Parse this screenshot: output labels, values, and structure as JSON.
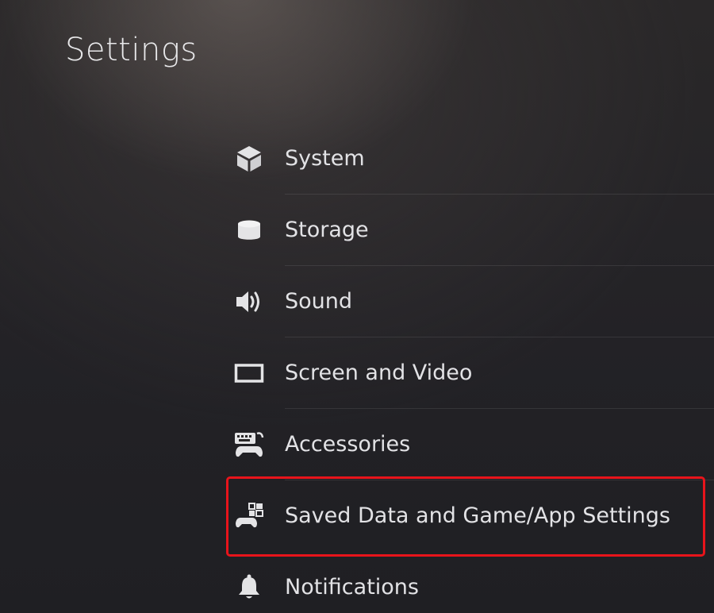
{
  "page": {
    "title": "Settings"
  },
  "menu": {
    "items": [
      {
        "label": "System",
        "icon": "cube-icon"
      },
      {
        "label": "Storage",
        "icon": "storage-cylinder-icon"
      },
      {
        "label": "Sound",
        "icon": "speaker-icon"
      },
      {
        "label": "Screen and Video",
        "icon": "screen-icon"
      },
      {
        "label": "Accessories",
        "icon": "keyboard-controller-icon"
      },
      {
        "label": "Saved Data and Game/App Settings",
        "icon": "controller-grid-icon",
        "highlighted": true
      },
      {
        "label": "Notifications",
        "icon": "bell-icon"
      }
    ]
  },
  "colors": {
    "background": "#232226",
    "text": "#e2e2e5",
    "highlight_border": "#e8141b"
  }
}
